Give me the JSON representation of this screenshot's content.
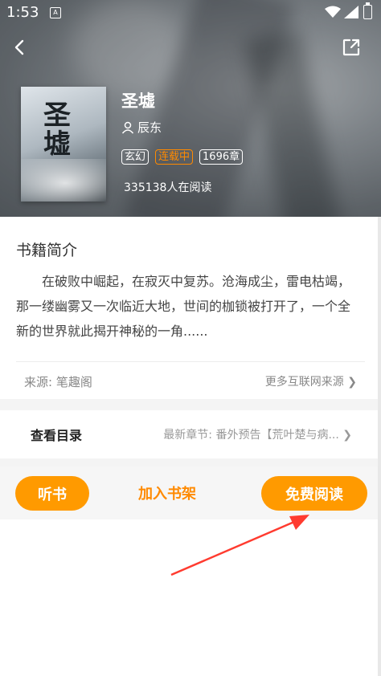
{
  "status_bar": {
    "time": "1:53",
    "sim_label": "A"
  },
  "book": {
    "title": "圣墟",
    "author": "辰东",
    "tags": [
      "玄幻",
      "连载中",
      "1696章"
    ],
    "readers": "335138人在阅读",
    "cover_art_text": "圣墟"
  },
  "intro": {
    "heading": "书籍简介",
    "text": "在破败中崛起，在寂灭中复苏。沧海成尘，雷电枯竭，那一缕幽雾又一次临近大地，世间的枷锁被打开了，一个全新的世界就此揭开神秘的一角......"
  },
  "source": {
    "label": "来源: 笔趣阁",
    "more": "更多互联网来源 ❯"
  },
  "toc": {
    "label": "查看目录",
    "latest": "最新章节: 番外预告【荒叶楚与病... ❯"
  },
  "actions": {
    "listen": "听书",
    "add_shelf": "加入书架",
    "read_free": "免费阅读"
  },
  "colors": {
    "accent": "#ff9a00",
    "tag_highlight": "#ff8a00",
    "annotation_arrow": "#ff3b2f"
  }
}
